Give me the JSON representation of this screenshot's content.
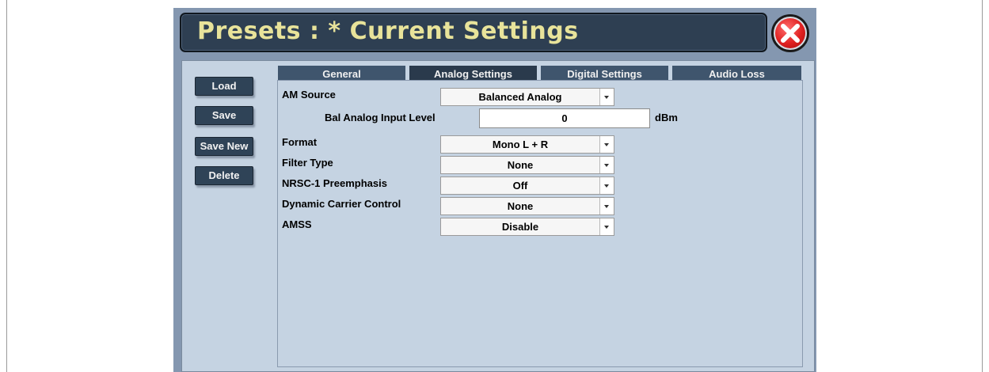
{
  "title": {
    "prefix": "Presets",
    "separator": " : * ",
    "name": "Current Settings"
  },
  "close_icon": "close-x-icon",
  "sidebar": {
    "load_label": "Load",
    "save_label": "Save",
    "save_new_label": "Save New",
    "delete_label": "Delete"
  },
  "tabs": [
    {
      "label": "General",
      "active": false
    },
    {
      "label": "Analog Settings",
      "active": true
    },
    {
      "label": "Digital Settings",
      "active": false
    },
    {
      "label": "Audio Loss",
      "active": false
    }
  ],
  "settings": {
    "am_source": {
      "label": "AM Source",
      "value": "Balanced Analog"
    },
    "bal_analog_input_level": {
      "label": "Bal Analog Input Level",
      "value": "0",
      "unit": "dBm"
    },
    "format": {
      "label": "Format",
      "value": "Mono L + R"
    },
    "filter_type": {
      "label": "Filter Type",
      "value": "None"
    },
    "nrsc1_preemphasis": {
      "label": "NRSC-1 Preemphasis",
      "value": "Off"
    },
    "dynamic_carrier_control": {
      "label": "Dynamic Carrier Control",
      "value": "None"
    },
    "amss": {
      "label": "AMSS",
      "value": "Disable"
    }
  },
  "colors": {
    "title_text": "#e8e39a",
    "title_bg": "#2e3f52",
    "window_bg": "#8497b0",
    "content_bg": "#c5d3e2",
    "tab_bg": "#3f556d",
    "tab_active_bg": "#2a3a4c",
    "button_bg": "#2f4357"
  }
}
